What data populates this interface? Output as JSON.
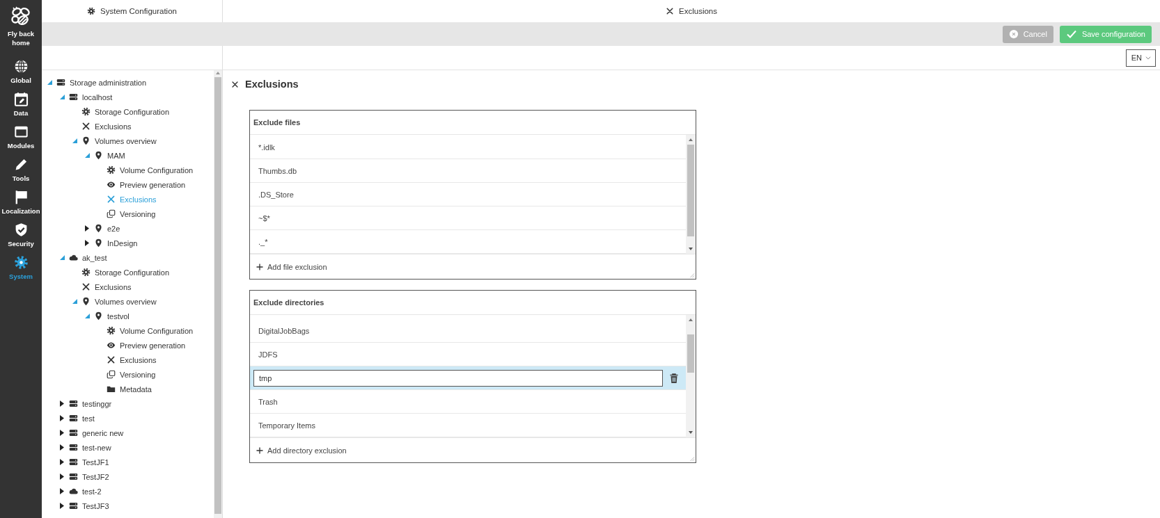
{
  "nav": {
    "home_label": "Fly back home",
    "items": [
      {
        "label": "Global",
        "kind": "globe",
        "selected": false
      },
      {
        "label": "Data",
        "kind": "calendar",
        "selected": false
      },
      {
        "label": "Modules",
        "kind": "window",
        "selected": false
      },
      {
        "label": "Tools",
        "kind": "pencil",
        "selected": false
      },
      {
        "label": "Localization",
        "kind": "flag",
        "selected": false
      },
      {
        "label": "Security",
        "kind": "shield",
        "selected": false
      },
      {
        "label": "System",
        "kind": "gear",
        "selected": true
      }
    ]
  },
  "left_header": {
    "title": "System Configuration"
  },
  "right_header": {
    "title": "Exclusions"
  },
  "toolbar": {
    "buttons": [
      {
        "label": "Cancel",
        "kind": "cancel"
      },
      {
        "label": "Save configuration",
        "kind": "save"
      }
    ],
    "language": "EN"
  },
  "tree": {
    "items": [
      {
        "label": "Storage administration",
        "kind": "server",
        "expanded": true,
        "selected": false,
        "children": [
          {
            "label": "localhost",
            "kind": "server",
            "expanded": true,
            "selected": false,
            "children": [
              {
                "label": "Storage Configuration",
                "kind": "settings",
                "selected": false
              },
              {
                "label": "Exclusions",
                "kind": "exclusions",
                "selected": false
              },
              {
                "label": "Volumes overview",
                "kind": "volume",
                "expanded": true,
                "selected": false,
                "children": [
                  {
                    "label": "MAM",
                    "kind": "volume",
                    "expanded": true,
                    "selected": false,
                    "children": [
                      {
                        "label": "Volume Configuration",
                        "kind": "settings",
                        "selected": false
                      },
                      {
                        "label": "Preview generation",
                        "kind": "preview",
                        "selected": false
                      },
                      {
                        "label": "Exclusions",
                        "kind": "exclusions",
                        "selected": true
                      },
                      {
                        "label": "Versioning",
                        "kind": "versioning",
                        "selected": false
                      }
                    ]
                  },
                  {
                    "label": "e2e",
                    "kind": "volume",
                    "expanded": false,
                    "selected": false
                  },
                  {
                    "label": "InDesign",
                    "kind": "volume",
                    "expanded": false,
                    "selected": false
                  }
                ]
              }
            ]
          },
          {
            "label": "ak_test",
            "kind": "cloud",
            "expanded": true,
            "selected": false,
            "children": [
              {
                "label": "Storage Configuration",
                "kind": "settings",
                "selected": false
              },
              {
                "label": "Exclusions",
                "kind": "exclusions",
                "selected": false
              },
              {
                "label": "Volumes overview",
                "kind": "volume",
                "expanded": true,
                "selected": false,
                "children": [
                  {
                    "label": "testvol",
                    "kind": "volume",
                    "expanded": true,
                    "selected": false,
                    "children": [
                      {
                        "label": "Volume Configuration",
                        "kind": "settings",
                        "selected": false
                      },
                      {
                        "label": "Preview generation",
                        "kind": "preview",
                        "selected": false
                      },
                      {
                        "label": "Exclusions",
                        "kind": "exclusions",
                        "selected": false
                      },
                      {
                        "label": "Versioning",
                        "kind": "versioning",
                        "selected": false
                      },
                      {
                        "label": "Metadata",
                        "kind": "metadata",
                        "selected": false
                      }
                    ]
                  }
                ]
              }
            ]
          },
          {
            "label": "testinggr",
            "kind": "server",
            "expanded": false,
            "selected": false
          },
          {
            "label": "test",
            "kind": "server",
            "expanded": false,
            "selected": false
          },
          {
            "label": "generic new",
            "kind": "server",
            "expanded": false,
            "selected": false
          },
          {
            "label": "test-new",
            "kind": "server",
            "expanded": false,
            "selected": false
          },
          {
            "label": "TestJF1",
            "kind": "server",
            "expanded": false,
            "selected": false
          },
          {
            "label": "TestJF2",
            "kind": "server",
            "expanded": false,
            "selected": false
          },
          {
            "label": "test-2",
            "kind": "cloud",
            "expanded": false,
            "selected": false
          },
          {
            "label": "TestJF3",
            "kind": "server",
            "expanded": false,
            "selected": false
          }
        ]
      }
    ]
  },
  "page": {
    "title": "Exclusions",
    "sections": [
      {
        "title": "Exclude files",
        "add_label": "Add file exclusion",
        "items": [
          {
            "text": "*.idlk",
            "selected": false
          },
          {
            "text": "Thumbs.db",
            "selected": false
          },
          {
            "text": ".DS_Store",
            "selected": false
          },
          {
            "text": "~$*",
            "selected": false
          },
          {
            "text": "._*",
            "selected": false
          }
        ]
      },
      {
        "title": "Exclude directories",
        "add_label": "Add directory exclusion",
        "items": [
          {
            "text": "DigitalJobBags",
            "selected": false
          },
          {
            "text": "JDFS",
            "selected": false
          },
          {
            "text": "tmp",
            "selected": true
          },
          {
            "text": "Trash",
            "selected": false
          },
          {
            "text": "Temporary Items",
            "selected": false
          }
        ]
      }
    ]
  }
}
